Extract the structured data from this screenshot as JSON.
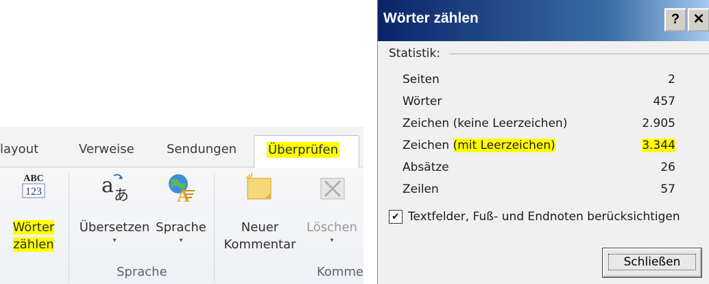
{
  "ribbon": {
    "tabs": [
      {
        "label": "layout"
      },
      {
        "label": "Verweise"
      },
      {
        "label": "Sendungen"
      },
      {
        "label": "Überprüfen",
        "active": true,
        "highlighted": true
      }
    ],
    "commands": {
      "word_count_icon": "ABC\n123",
      "word_count_line1": "Wörter",
      "word_count_line2": "zählen",
      "translate": "Übersetzen",
      "language": "Sprache",
      "new_comment_line1": "Neuer",
      "new_comment_line2": "Kommentar",
      "delete": "Löschen"
    },
    "groups": {
      "sprache": "Sprache",
      "kommentare": "Komme"
    },
    "icons": {
      "translate": "translate-icon",
      "language": "globe-language-icon",
      "new_comment": "new-comment-icon",
      "delete_comment": "delete-comment-icon"
    }
  },
  "dialog": {
    "title": "Wörter zählen",
    "help_btn": "?",
    "close_btn": "✕",
    "section": "Statistik:",
    "stats": [
      {
        "label": "Seiten",
        "value": "2"
      },
      {
        "label": "Wörter",
        "value": "457"
      },
      {
        "label": "Zeichen (keine Leerzeichen)",
        "value": "2.905"
      },
      {
        "label_prefix": "Zeichen ",
        "label_hl": "(mit Leerzeichen)",
        "value": "3.344",
        "highlighted": true
      },
      {
        "label": "Absätze",
        "value": "26"
      },
      {
        "label": "Zeilen",
        "value": "57"
      }
    ],
    "checkbox_label": "Textfelder, Fuß- und Endnoten berücksichtigen",
    "checkbox_checked": true,
    "close_button": "Schließen"
  },
  "colors": {
    "highlight": "#ffff00",
    "titlebar_start": "#0a246a",
    "titlebar_end": "#a6caf0"
  }
}
